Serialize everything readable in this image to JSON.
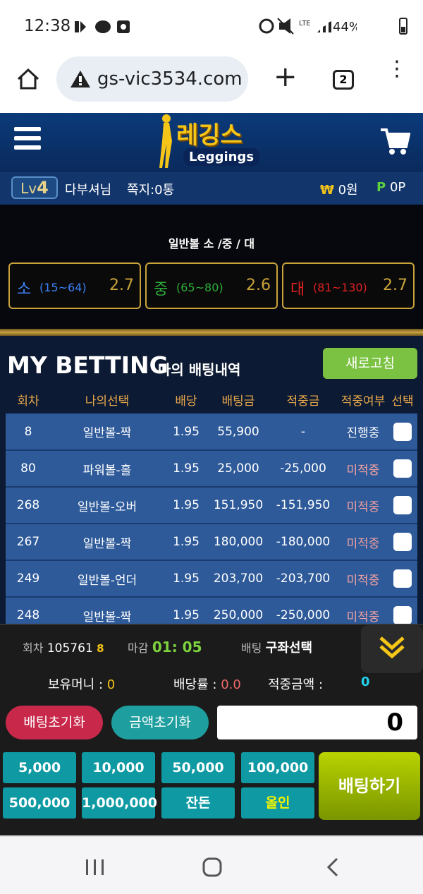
{
  "status": {
    "time": "12:38",
    "lte": "LTE",
    "battery": "44%"
  },
  "browser": {
    "url": "gs-vic3534.com",
    "tab_count": "2"
  },
  "site": {
    "logo_korean": "레깅스",
    "logo_english": "Leggings"
  },
  "user": {
    "level_prefix": "Lv",
    "level": "4",
    "name": "다부셔님",
    "messages": "쪽지:0통",
    "won_symbol": "₩",
    "money": "0원",
    "point_symbol": "P",
    "points": "0P"
  },
  "game": {
    "title": "일반볼 소 /중 / 대",
    "options": [
      {
        "key": "소",
        "range": "(15~64)",
        "odds": "2.7",
        "color": "#3b82f6"
      },
      {
        "key": "중",
        "range": "(65~80)",
        "odds": "2.6",
        "color": "#2fae3a"
      },
      {
        "key": "대",
        "range": "(81~130)",
        "odds": "2.7",
        "color": "#e02020"
      }
    ]
  },
  "history": {
    "title": "MY BETTING",
    "subtitle": "나의 배팅내역",
    "refresh_label": "새로고침",
    "columns": [
      "회차",
      "나의선택",
      "배당",
      "배팅금",
      "적중금",
      "적중여부",
      "선택"
    ],
    "rows": [
      {
        "round": "8",
        "choice": "일반볼-짝",
        "odds": "1.95",
        "stake": "55,900",
        "win": "-",
        "result": "진행중"
      },
      {
        "round": "80",
        "choice": "파워볼-홀",
        "odds": "1.95",
        "stake": "25,000",
        "win": "-25,000",
        "result": "미적중"
      },
      {
        "round": "268",
        "choice": "일반볼-오버",
        "odds": "1.95",
        "stake": "151,950",
        "win": "-151,950",
        "result": "미적중"
      },
      {
        "round": "267",
        "choice": "일반볼-짝",
        "odds": "1.95",
        "stake": "180,000",
        "win": "-180,000",
        "result": "미적중"
      },
      {
        "round": "249",
        "choice": "일반볼-언더",
        "odds": "1.95",
        "stake": "203,700",
        "win": "-203,700",
        "result": "미적중"
      },
      {
        "round": "248",
        "choice": "일반볼-짝",
        "odds": "1.95",
        "stake": "250,000",
        "win": "-250,000",
        "result": "미적중"
      }
    ]
  },
  "panel": {
    "round_label": "회차",
    "round_value": "105761",
    "round_sub": "8",
    "deadline_label": "마감",
    "deadline_value": "01: 05",
    "bet_label": "배팅",
    "bet_value": "구좌선택",
    "balance_label": "보유머니 :",
    "balance_value": "0",
    "rate_label": "배당률 :",
    "rate_value": "0.0",
    "payout_label": "적중금액 :",
    "payout_value": "0",
    "reset_bet": "배팅초기화",
    "reset_amount": "금액초기화",
    "amount_value": "0",
    "quick": [
      "5,000",
      "10,000",
      "50,000",
      "100,000",
      "500,000",
      "1,000,000",
      "잔돈",
      "올인"
    ],
    "bet_button": "배팅하기"
  }
}
